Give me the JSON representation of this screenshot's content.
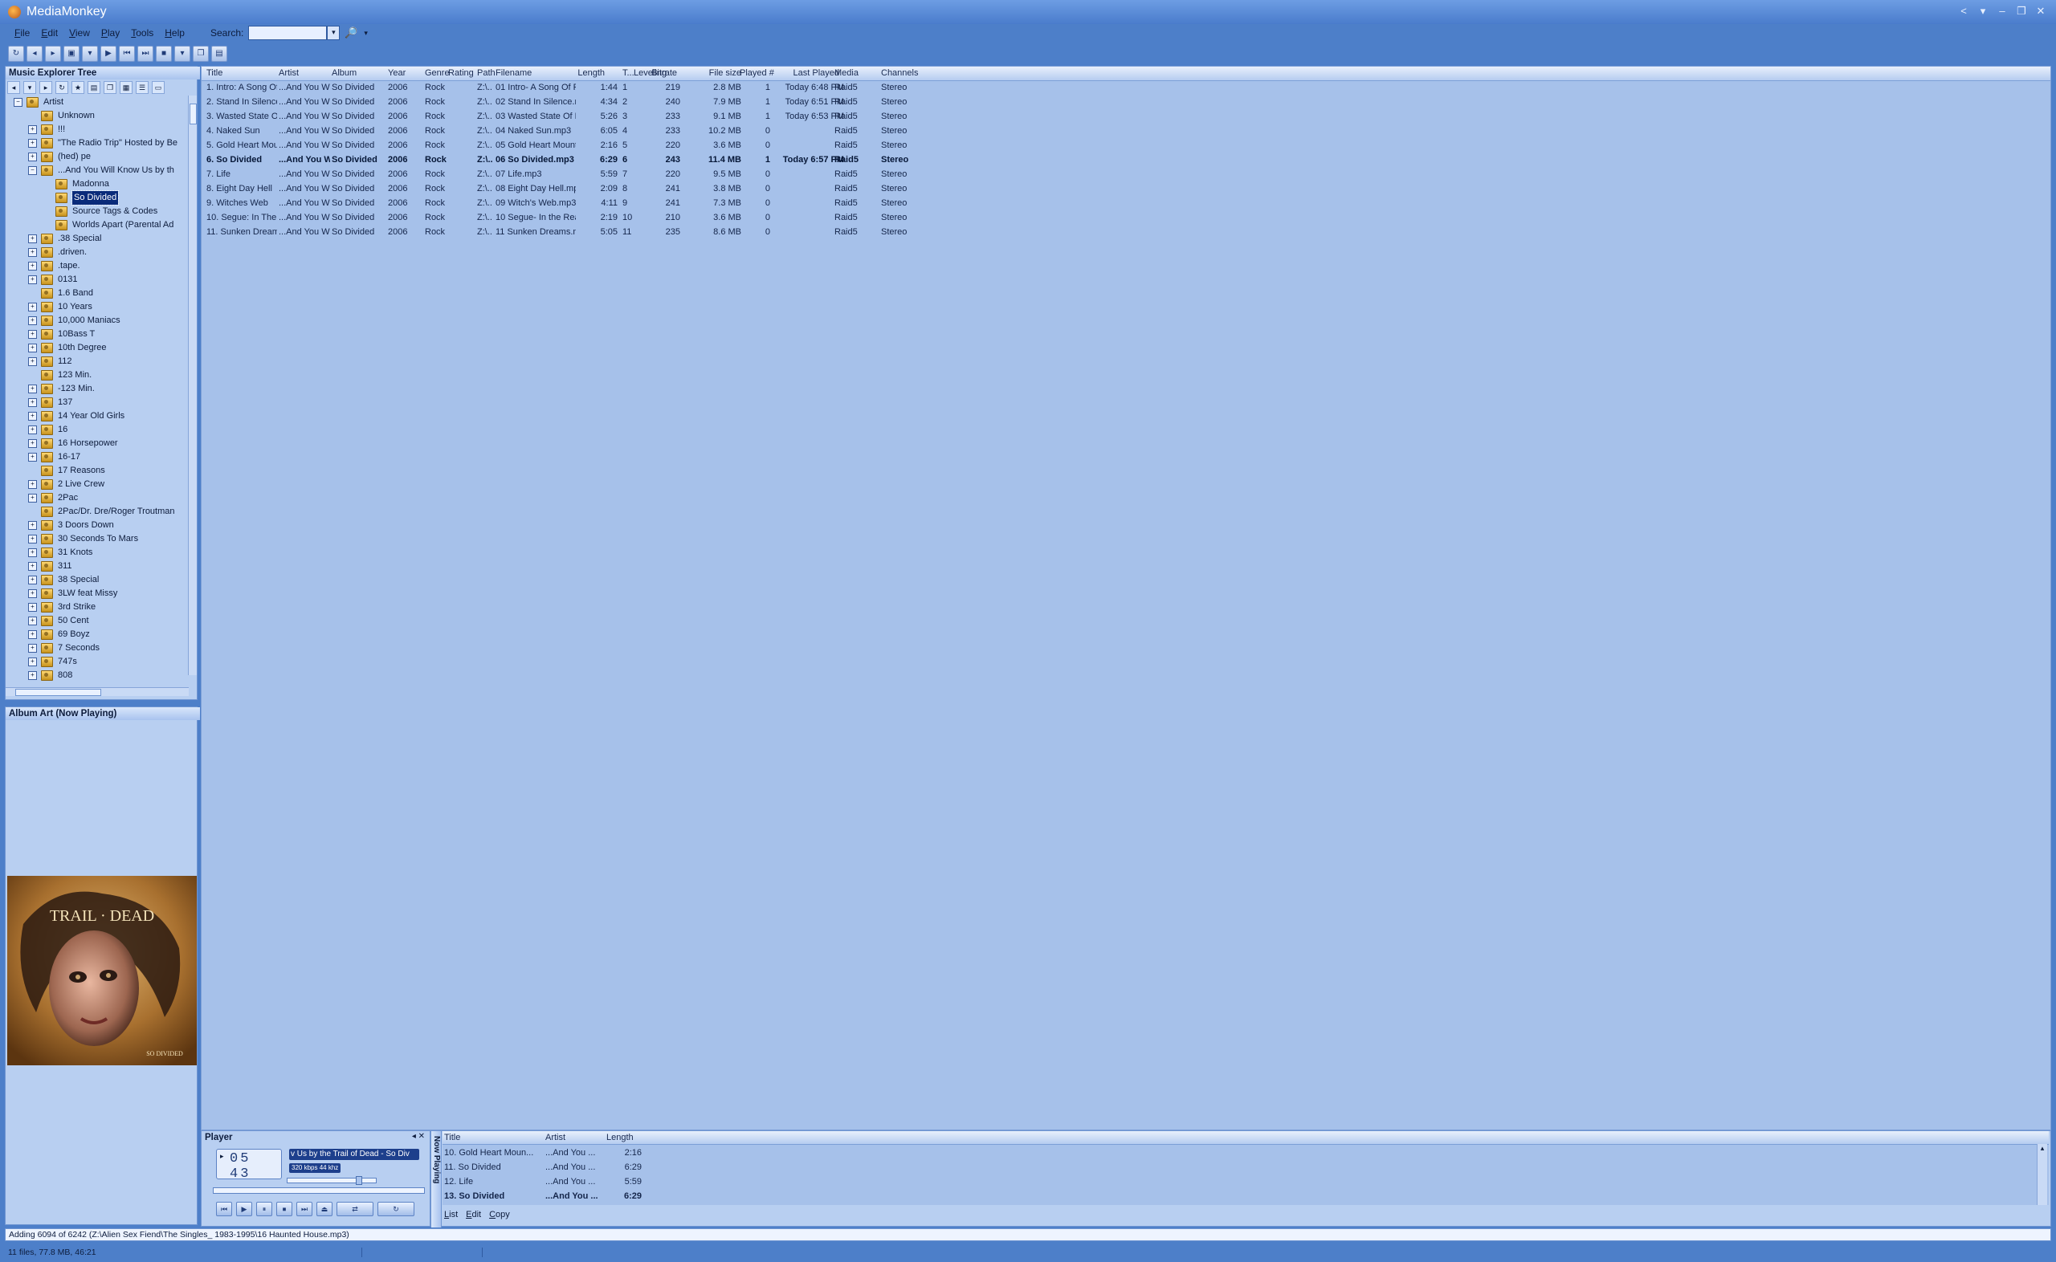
{
  "window": {
    "title": "MediaMonkey",
    "controls": [
      "<",
      "▾",
      "–",
      "❐",
      "✕"
    ]
  },
  "menu": [
    {
      "label": "File"
    },
    {
      "label": "Edit"
    },
    {
      "label": "View"
    },
    {
      "label": "Play"
    },
    {
      "label": "Tools"
    },
    {
      "label": "Help"
    }
  ],
  "search": {
    "label": "Search:",
    "value": "",
    "dropdown": "▾",
    "go_icon": "🔎"
  },
  "toolbar": {
    "icons": [
      "refresh-icon",
      "back-icon",
      "forward-icon",
      "save-icon",
      "dropdown-icon",
      "play-icon",
      "prev-icon",
      "next-icon",
      "stop-icon",
      "dropdown-icon",
      "copy-icon",
      "folder-icon"
    ]
  },
  "tree_panel": {
    "title": "Music Explorer Tree",
    "items": [
      {
        "label": "Artist",
        "level": 0,
        "expander": "−"
      },
      {
        "label": "Unknown",
        "level": 1,
        "expander": ""
      },
      {
        "label": "!!!",
        "level": 1,
        "expander": "+"
      },
      {
        "label": "\"The Radio Trip\" Hosted by Be",
        "level": 1,
        "expander": "+"
      },
      {
        "label": "(hed) pe",
        "level": 1,
        "expander": "+"
      },
      {
        "label": "...And You Will Know Us by th",
        "level": 1,
        "expander": "−"
      },
      {
        "label": "Madonna",
        "level": 2,
        "expander": ""
      },
      {
        "label": "So Divided",
        "level": 2,
        "expander": "",
        "selected": true
      },
      {
        "label": "Source Tags & Codes",
        "level": 2,
        "expander": ""
      },
      {
        "label": "Worlds Apart (Parental Ad",
        "level": 2,
        "expander": ""
      },
      {
        "label": ".38 Special",
        "level": 1,
        "expander": "+"
      },
      {
        "label": ".driven.",
        "level": 1,
        "expander": "+"
      },
      {
        "label": ".tape.",
        "level": 1,
        "expander": "+"
      },
      {
        "label": "0131",
        "level": 1,
        "expander": "+"
      },
      {
        "label": "1.6 Band",
        "level": 1,
        "expander": ""
      },
      {
        "label": "10 Years",
        "level": 1,
        "expander": "+"
      },
      {
        "label": "10,000 Maniacs",
        "level": 1,
        "expander": "+"
      },
      {
        "label": "10Bass T",
        "level": 1,
        "expander": "+"
      },
      {
        "label": "10th Degree",
        "level": 1,
        "expander": "+"
      },
      {
        "label": "112",
        "level": 1,
        "expander": "+"
      },
      {
        "label": "123 Min.",
        "level": 1,
        "expander": ""
      },
      {
        "label": "-123 Min.",
        "level": 1,
        "expander": "+"
      },
      {
        "label": "137",
        "level": 1,
        "expander": "+"
      },
      {
        "label": "14 Year Old Girls",
        "level": 1,
        "expander": "+"
      },
      {
        "label": "16",
        "level": 1,
        "expander": "+"
      },
      {
        "label": "16 Horsepower",
        "level": 1,
        "expander": "+"
      },
      {
        "label": "16-17",
        "level": 1,
        "expander": "+"
      },
      {
        "label": "17 Reasons",
        "level": 1,
        "expander": ""
      },
      {
        "label": "2 Live Crew",
        "level": 1,
        "expander": "+"
      },
      {
        "label": "2Pac",
        "level": 1,
        "expander": "+"
      },
      {
        "label": "2Pac/Dr. Dre/Roger Troutman",
        "level": 1,
        "expander": ""
      },
      {
        "label": "3 Doors Down",
        "level": 1,
        "expander": "+"
      },
      {
        "label": "30 Seconds To Mars",
        "level": 1,
        "expander": "+"
      },
      {
        "label": "31 Knots",
        "level": 1,
        "expander": "+"
      },
      {
        "label": "311",
        "level": 1,
        "expander": "+"
      },
      {
        "label": "38 Special",
        "level": 1,
        "expander": "+"
      },
      {
        "label": "3LW feat Missy",
        "level": 1,
        "expander": "+"
      },
      {
        "label": "3rd Strike",
        "level": 1,
        "expander": "+"
      },
      {
        "label": "50 Cent",
        "level": 1,
        "expander": "+"
      },
      {
        "label": "69 Boyz",
        "level": 1,
        "expander": "+"
      },
      {
        "label": "7 Seconds",
        "level": 1,
        "expander": "+"
      },
      {
        "label": "747s",
        "level": 1,
        "expander": "+"
      },
      {
        "label": "808",
        "level": 1,
        "expander": "+"
      }
    ]
  },
  "art_panel": {
    "title": "Album Art (Now Playing)",
    "art_text_top": "TRAIL · DEAD",
    "art_text_bottom": "SO DIVIDED"
  },
  "tracklist": {
    "columns": [
      "Title",
      "Artist",
      "Album",
      "Year",
      "Genre",
      "Rating",
      "Path",
      "Filename",
      "Length",
      "T...",
      "Leveling",
      "Bitrate",
      "File size",
      "Played #",
      "Last Played",
      "Media",
      "Channels"
    ],
    "rows": [
      [
        "1. Intro: A Song Of Fire A...",
        "...And You Will Kn...",
        "So Divided",
        "2006",
        "Rock",
        "",
        "Z:\\...",
        "01 Intro- A Song Of Fire And ...",
        "1:44",
        "1",
        "",
        "219",
        "2.8 MB",
        "1",
        "Today 6:48 PM",
        "Raid5",
        "Stereo"
      ],
      [
        "2. Stand In Silence",
        "...And You Will Kn...",
        "So Divided",
        "2006",
        "Rock",
        "",
        "Z:\\...",
        "02 Stand In Silence.mp3",
        "4:34",
        "2",
        "",
        "240",
        "7.9 MB",
        "1",
        "Today 6:51 PM",
        "Raid5",
        "Stereo"
      ],
      [
        "3. Wasted State Of Mind",
        "...And You Will Kn...",
        "So Divided",
        "2006",
        "Rock",
        "",
        "Z:\\...",
        "03 Wasted State Of Mind.mp3",
        "5:26",
        "3",
        "",
        "233",
        "9.1 MB",
        "1",
        "Today 6:53 PM",
        "Raid5",
        "Stereo"
      ],
      [
        "4. Naked Sun",
        "...And You Will Kn...",
        "So Divided",
        "2006",
        "Rock",
        "",
        "Z:\\...",
        "04 Naked Sun.mp3",
        "6:05",
        "4",
        "",
        "233",
        "10.2 MB",
        "0",
        "",
        "Raid5",
        "Stereo"
      ],
      [
        "5. Gold Heart Mountain To...",
        "...And You Will Kn...",
        "So Divided",
        "2006",
        "Rock",
        "",
        "Z:\\...",
        "05 Gold Heart Mountain Top Q...",
        "2:16",
        "5",
        "",
        "220",
        "3.6 MB",
        "0",
        "",
        "Raid5",
        "Stereo"
      ],
      [
        "6. So Divided",
        "...And You Will K...",
        "So Divided",
        "2006",
        "Rock",
        "",
        "Z:\\...",
        "06 So Divided.mp3",
        "6:29",
        "6",
        "",
        "243",
        "11.4 MB",
        "1",
        "Today 6:57 PM",
        "Raid5",
        "Stereo"
      ],
      [
        "7. Life",
        "...And You Will Kn...",
        "So Divided",
        "2006",
        "Rock",
        "",
        "Z:\\...",
        "07 Life.mp3",
        "5:59",
        "7",
        "",
        "220",
        "9.5 MB",
        "0",
        "",
        "Raid5",
        "Stereo"
      ],
      [
        "8. Eight Day Hell",
        "...And You Will Kn...",
        "So Divided",
        "2006",
        "Rock",
        "",
        "Z:\\...",
        "08 Eight Day Hell.mp3",
        "2:09",
        "8",
        "",
        "241",
        "3.8 MB",
        "0",
        "",
        "Raid5",
        "Stereo"
      ],
      [
        "9. Witches Web",
        "...And You Will Kn...",
        "So Divided",
        "2006",
        "Rock",
        "",
        "Z:\\...",
        "09 Witch's Web.mp3",
        "4:11",
        "9",
        "",
        "241",
        "7.3 MB",
        "0",
        "",
        "Raid5",
        "Stereo"
      ],
      [
        "10. Segue: In The Realms...",
        "...And You Will Kn...",
        "So Divided",
        "2006",
        "Rock",
        "",
        "Z:\\...",
        "10 Segue- In the Realms of th...",
        "2:19",
        "10",
        "",
        "210",
        "3.6 MB",
        "0",
        "",
        "Raid5",
        "Stereo"
      ],
      [
        "11. Sunken Dreams",
        "...And You Will Kn...",
        "So Divided",
        "2006",
        "Rock",
        "",
        "Z:\\...",
        "11 Sunken Dreams.mp3",
        "5:05",
        "11",
        "",
        "235",
        "8.6 MB",
        "0",
        "",
        "Raid5",
        "Stereo"
      ]
    ],
    "bold_row": 5
  },
  "player": {
    "title": "Player",
    "state_icon": "▸",
    "time": "05 43",
    "marquee": "v Us by the Trail of Dead - So Div",
    "bitrate": "320 kbps 44 khz",
    "volume": 0.85,
    "transport": [
      "⏮",
      "▶",
      "⏸",
      "⏹",
      "⏭",
      "⏏",
      "⇄",
      "↻"
    ]
  },
  "now_playing": {
    "tab_label": "Now Playing",
    "columns": [
      "Title",
      "Artist",
      "Length"
    ],
    "rows": [
      [
        "10. Gold Heart Moun...",
        "...And You ...",
        "2:16"
      ],
      [
        "11. So Divided",
        "...And You ...",
        "6:29"
      ],
      [
        "12. Life",
        "...And You ...",
        "5:59"
      ],
      [
        "13. So Divided",
        "...And You ...",
        "6:29"
      ]
    ],
    "bold_row": 3,
    "footer": [
      "List",
      "Edit",
      "Copy"
    ]
  },
  "status": {
    "message": "Adding 6094 of 6242 (Z:\\Alien Sex Fiend\\The Singles_ 1983-1995\\16 Haunted House.mp3)"
  },
  "info": {
    "summary": "11 files, 77.8 MB, 46:21"
  }
}
